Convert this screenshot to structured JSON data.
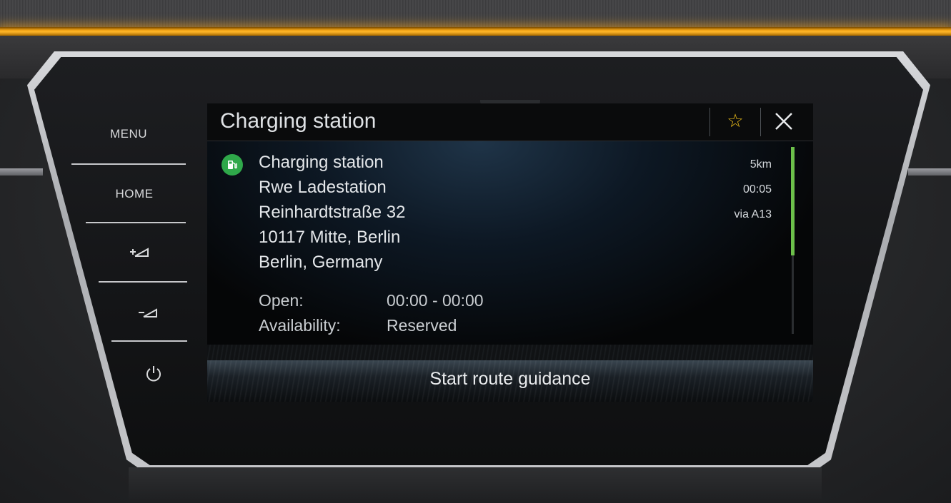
{
  "hardware_buttons": {
    "menu": "MENU",
    "home": "HOME",
    "volume_up_icon": "volume-up-icon",
    "volume_down_icon": "volume-down-icon",
    "power_icon": "power-icon"
  },
  "screen": {
    "title": "Charging station",
    "favorite_icon": "star-icon",
    "close_icon": "close-icon",
    "poi": {
      "icon": "charging-station-icon",
      "icon_color": "#2fa84a",
      "name": "Charging station",
      "operator": "Rwe Ladestation",
      "street": "Reinhardtstraße 32",
      "city": "10117 Mitte, Berlin",
      "region": "Berlin, Germany",
      "distance": "5km",
      "duration": "00:05",
      "via": "via A13"
    },
    "details": [
      {
        "label": "Open:",
        "value": "00:00 - 00:00"
      },
      {
        "label": "Availability:",
        "value": "Reserved"
      }
    ],
    "primary_action": "Start route guidance"
  },
  "colors": {
    "accent_star": "#f2c21a",
    "scroll_accent": "#6cc04a",
    "ambient_light": "#ffb628"
  }
}
